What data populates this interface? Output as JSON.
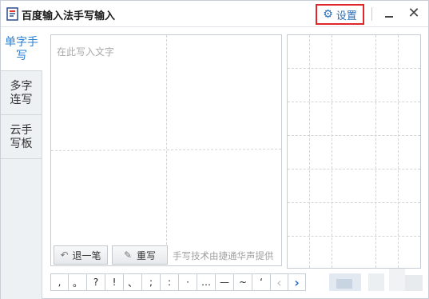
{
  "titlebar": {
    "title": "百度输入法手写输入",
    "settings_label": "设置",
    "close_glyph": "✕"
  },
  "sidetabs": [
    {
      "label": "单字手写",
      "active": true
    },
    {
      "label": "多字连写",
      "active": false
    },
    {
      "label": "云手写板",
      "active": false
    }
  ],
  "canvas": {
    "placeholder": "在此写入文字",
    "undo_label": "退一笔",
    "rewrite_label": "重写",
    "credit": "手写技术由捷通华声提供"
  },
  "symbols": [
    ",",
    "。",
    "?",
    "!",
    "、",
    ";",
    ":",
    "·",
    "…",
    "—",
    "~",
    "‘"
  ],
  "nav": {
    "prev": "‹",
    "next": "›"
  },
  "colors": {
    "accent": "#2d6db5",
    "active_tab": "#2d7fd0",
    "highlight_border": "#e0252b"
  }
}
